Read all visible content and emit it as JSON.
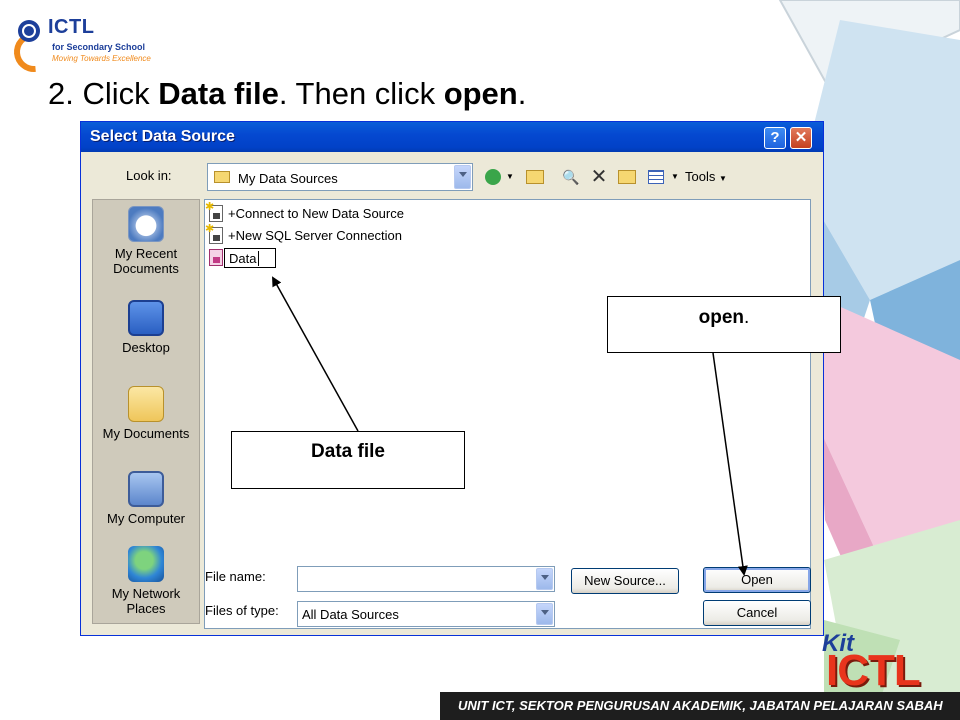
{
  "slide": {
    "title_prefix": "2. Click ",
    "title_bold1": "Data file",
    "title_mid": ". Then click ",
    "title_bold2": "open",
    "title_end": ".",
    "logo_top_brand": "ICTL",
    "logo_top_sub": "for Secondary School",
    "logo_top_tag": "Moving Towards Excellence",
    "logo_bottom_kit": "Kit",
    "logo_bottom_ictl": "ICTL",
    "footer": "UNIT ICT, SEKTOR PENGURUSAN AKADEMIK, JABATAN PELAJARAN SABAH",
    "colors": {
      "logo_blue": "#1d3f9a",
      "logo_orange": "#f08a1c",
      "logo_red": "#e8341c"
    }
  },
  "dialog": {
    "title": "Select Data Source",
    "help_label": "?",
    "close_label": "✕",
    "look_in_label": "Look in:",
    "look_in_value": "My Data Sources",
    "toolbar": {
      "tools_label": "Tools",
      "icons": [
        "back-icon",
        "up-folder-icon",
        "search-web-icon",
        "delete-icon",
        "new-folder-icon",
        "views-icon"
      ]
    },
    "places": [
      {
        "label": "My Recent Documents",
        "icon": "recent-documents-icon"
      },
      {
        "label": "Desktop",
        "icon": "desktop-icon"
      },
      {
        "label": "My Documents",
        "icon": "my-documents-icon"
      },
      {
        "label": "My Computer",
        "icon": "my-computer-icon"
      },
      {
        "label": "My Network Places",
        "icon": "network-places-icon"
      }
    ],
    "files": [
      {
        "name": "+Connect to New Data Source"
      },
      {
        "name": "+New SQL Server Connection"
      },
      {
        "name": "Data"
      }
    ],
    "file_name_label": "File name:",
    "file_name_value": "",
    "files_of_type_label": "Files of type:",
    "files_of_type_value": "All Data Sources",
    "new_source_button": "New Source...",
    "open_button": "Open",
    "cancel_button": "Cancel",
    "colors": {
      "titlebar": "#0549d1",
      "face": "#ece9d8",
      "border": "#0831d9"
    }
  },
  "callouts": {
    "open_text": "open",
    "open_dot": ".",
    "data_text": "Data file"
  }
}
